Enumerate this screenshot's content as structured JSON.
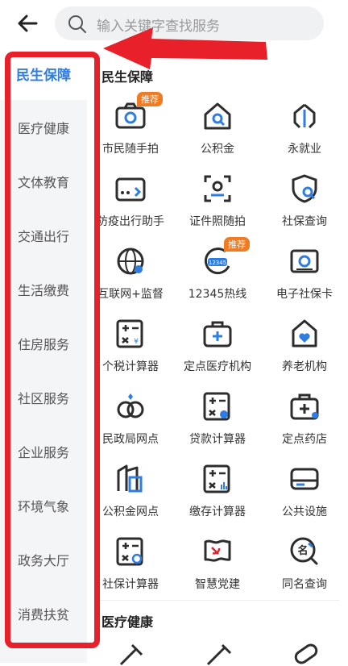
{
  "search": {
    "placeholder": "输入关键字查找服务"
  },
  "sidebar": {
    "items": [
      {
        "label": "民生保障",
        "active": true
      },
      {
        "label": "医疗健康"
      },
      {
        "label": "文体教育"
      },
      {
        "label": "交通出行"
      },
      {
        "label": "生活缴费"
      },
      {
        "label": "住房服务"
      },
      {
        "label": "社区服务"
      },
      {
        "label": "企业服务"
      },
      {
        "label": "环境气象"
      },
      {
        "label": "政务大厅"
      },
      {
        "label": "消费扶贫"
      }
    ]
  },
  "sections": [
    {
      "title": "民生保障",
      "items": [
        {
          "label": "市民随手拍",
          "icon": "camera-icon",
          "badge": "推荐"
        },
        {
          "label": "公积金",
          "icon": "house-search-icon"
        },
        {
          "label": "永就业",
          "icon": "hands-icon"
        },
        {
          "label": "防疫出行助手",
          "icon": "card-icon"
        },
        {
          "label": "证件照随拍",
          "icon": "id-photo-icon"
        },
        {
          "label": "社保查询",
          "icon": "shield-search-icon"
        },
        {
          "label": "互联网+监督",
          "icon": "globe-icon"
        },
        {
          "label": "12345热线",
          "icon": "hotline-icon",
          "badge": "推荐"
        },
        {
          "label": "电子社保卡",
          "icon": "social-card-icon"
        },
        {
          "label": "个税计算器",
          "icon": "tax-calculator-icon"
        },
        {
          "label": "定点医疗机构",
          "icon": "medical-kit-icon"
        },
        {
          "label": "养老机构",
          "icon": "elder-home-icon"
        },
        {
          "label": "民政局网点",
          "icon": "rings-icon"
        },
        {
          "label": "贷款计算器",
          "icon": "loan-calculator-icon"
        },
        {
          "label": "定点药店",
          "icon": "pharmacy-icon"
        },
        {
          "label": "公积金网点",
          "icon": "building-icon"
        },
        {
          "label": "缴存计算器",
          "icon": "deposit-calculator-icon"
        },
        {
          "label": "公共设施",
          "icon": "facility-icon"
        },
        {
          "label": "社保计算器",
          "icon": "social-calculator-icon"
        },
        {
          "label": "智慧党建",
          "icon": "party-flag-icon"
        },
        {
          "label": "同名查询",
          "icon": "name-search-icon"
        }
      ]
    },
    {
      "title": "医疗健康"
    }
  ],
  "colors": {
    "accent": "#2f7de1",
    "badge": "#f07b22",
    "highlight": "#e8202a"
  }
}
